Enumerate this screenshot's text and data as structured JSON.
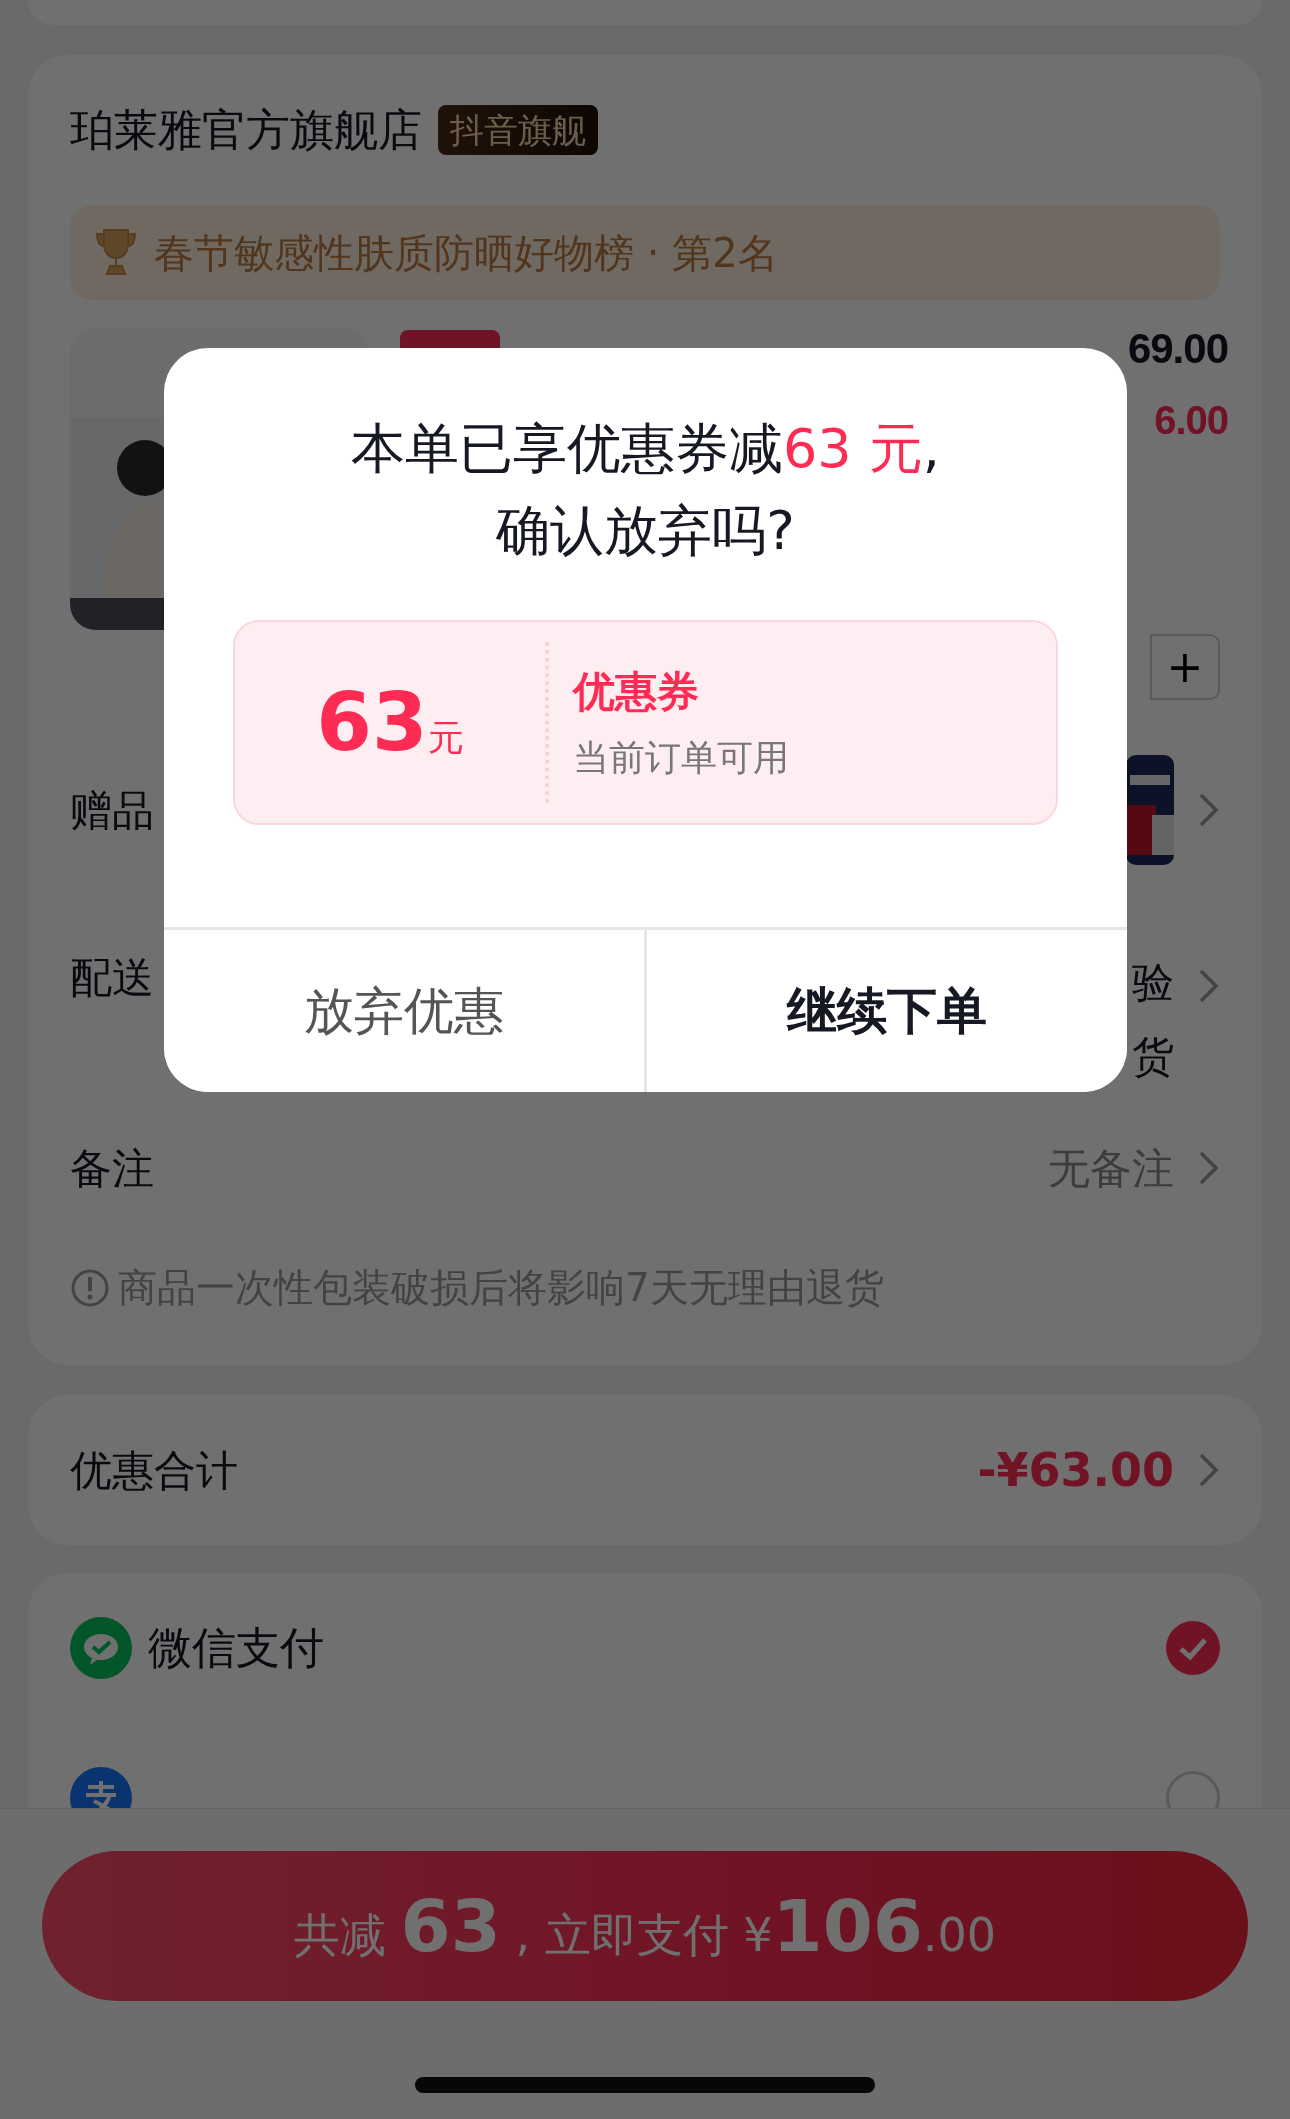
{
  "store": {
    "name": "珀莱雅官方旗舰店",
    "badge": "抖音旗舰",
    "ranking": "春节敏感性肤质防晒好物榜 · 第2名"
  },
  "product": {
    "price": "69.00",
    "discount_price": "6.00",
    "stepper_plus": "+"
  },
  "rows": [
    {
      "kind": "gift",
      "label": "赠品"
    },
    {
      "kind": "delivery",
      "label": "配送",
      "value": "验货"
    },
    {
      "kind": "remark",
      "label": "备注",
      "value": "无备注"
    }
  ],
  "notice": "商品一次性包装破损后将影响7天无理由退货",
  "discount_total": {
    "label": "优惠合计",
    "value": "-¥63.00"
  },
  "payment_methods": [
    {
      "name": "微信支付",
      "kind": "wechat",
      "selected": true
    },
    {
      "kind": "alipay",
      "selected": false
    }
  ],
  "pay_button": "共减 **63** , 立即支付 ¥**106**.00",
  "dialog": {
    "title_lines": [
      "本单已享优惠券减**63 元**,",
      "确认放弃吗?"
    ],
    "coupon": {
      "amount": "63",
      "unit": "元",
      "name": "优惠券",
      "description": "当前订单可用"
    },
    "buttons": [
      {
        "label": "放弃优惠",
        "kind": "secondary"
      },
      {
        "label": "继续下单",
        "kind": "primary"
      }
    ]
  }
}
